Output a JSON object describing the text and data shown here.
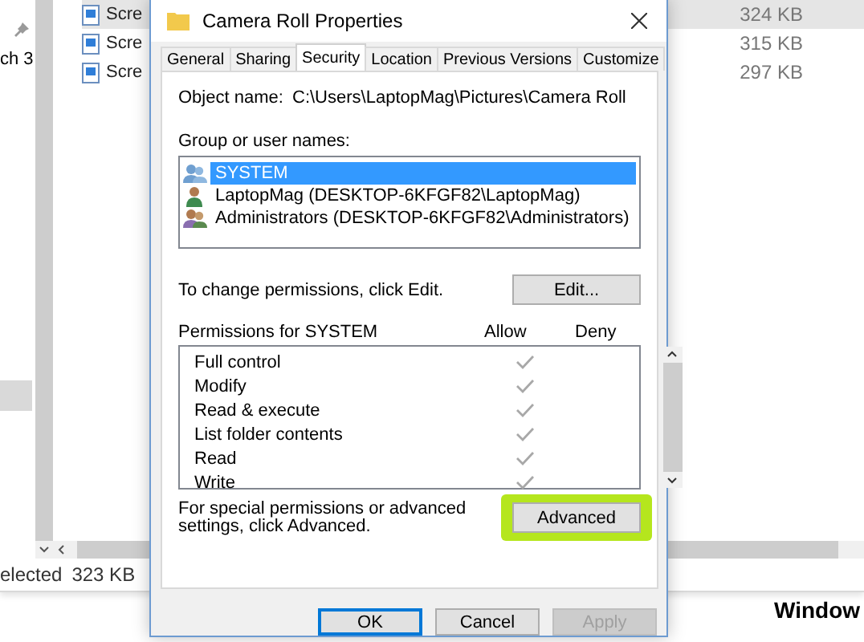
{
  "explorer": {
    "nav_label": "ch 3",
    "files": [
      {
        "name": "Scre",
        "size": "324 KB",
        "selected": true
      },
      {
        "name": "Scre",
        "size": "315 KB",
        "selected": false
      },
      {
        "name": "Scre",
        "size": "297 KB",
        "selected": false
      }
    ],
    "status_bar": {
      "selection": "elected",
      "size": "323 KB"
    }
  },
  "behind_text": "Window",
  "dialog": {
    "title": "Camera Roll Properties",
    "tabs": [
      {
        "label": "General",
        "selected": false
      },
      {
        "label": "Sharing",
        "selected": false
      },
      {
        "label": "Security",
        "selected": true
      },
      {
        "label": "Location",
        "selected": false
      },
      {
        "label": "Previous Versions",
        "selected": false
      },
      {
        "label": "Customize",
        "selected": false
      }
    ],
    "object_name_label": "Object name:",
    "object_name": "C:\\Users\\LaptopMag\\Pictures\\Camera Roll",
    "groups_label": "Group or user names:",
    "groups": [
      {
        "name": "SYSTEM",
        "kind": "system",
        "selected": true
      },
      {
        "name": "LaptopMag (DESKTOP-6KFGF82\\LaptopMag)",
        "kind": "user",
        "selected": false
      },
      {
        "name": "Administrators (DESKTOP-6KFGF82\\Administrators)",
        "kind": "group",
        "selected": false
      }
    ],
    "change_hint": "To change permissions, click Edit.",
    "edit_button": "Edit...",
    "permissions_label": "Permissions for SYSTEM",
    "allow_header": "Allow",
    "deny_header": "Deny",
    "permissions": [
      {
        "name": "Full control",
        "allow": true,
        "deny": false
      },
      {
        "name": "Modify",
        "allow": true,
        "deny": false
      },
      {
        "name": "Read & execute",
        "allow": true,
        "deny": false
      },
      {
        "name": "List folder contents",
        "allow": true,
        "deny": false
      },
      {
        "name": "Read",
        "allow": true,
        "deny": false
      },
      {
        "name": "Write",
        "allow": true,
        "deny": false
      }
    ],
    "advanced_hint": "For special permissions or advanced settings, click Advanced.",
    "advanced_button": {
      "label": "Advanced",
      "highlighted": true
    },
    "buttons": [
      {
        "label": "OK",
        "default": true,
        "disabled": false
      },
      {
        "label": "Cancel",
        "default": false,
        "disabled": false
      },
      {
        "label": "Apply",
        "default": false,
        "disabled": true
      }
    ]
  }
}
